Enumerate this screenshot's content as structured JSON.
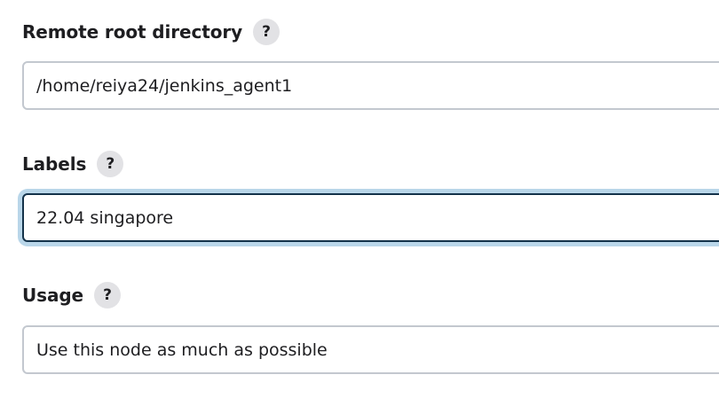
{
  "fields": [
    {
      "label": "Remote root directory",
      "help": "?",
      "value": "/home/reiya24/jenkins_agent1"
    },
    {
      "label": "Labels",
      "help": "?",
      "value": "22.04 singapore"
    },
    {
      "label": "Usage",
      "help": "?",
      "value": "Use this node as much as possible"
    }
  ],
  "colors": {
    "focus_border": "#14324a",
    "focus_ring": "#b9d6e9",
    "input_border": "#c3c8cf",
    "help_bg": "#e2e2e5"
  },
  "icons": {
    "help": "question-mark-circle-icon"
  }
}
